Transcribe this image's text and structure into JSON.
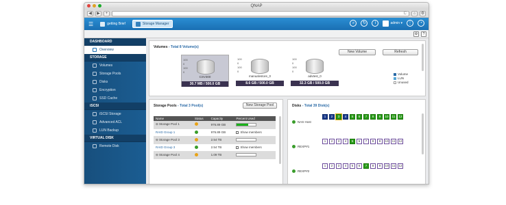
{
  "window": {
    "title": "QNAP"
  },
  "browser": {
    "back": "◀",
    "forward": "▶",
    "refresh": "C",
    "home": "⌂"
  },
  "appbar": {
    "tabs": [
      {
        "label": "getting Brief"
      },
      {
        "label": "Storage Manager"
      }
    ],
    "user": "admin ▾"
  },
  "sidebar": {
    "dashboard": "DASHBOARD",
    "overview": "Overview",
    "storage": "STORAGE",
    "storage_items": [
      "Volumes",
      "Storage Pools",
      "Disks",
      "Encryption",
      "SSD Cache"
    ],
    "iscsi": "iSCSI",
    "iscsi_items": [
      "iSCSI Storage",
      "Advanced ACL",
      "LUN Backup"
    ],
    "vdisk": "VIRTUAL DISK",
    "vdisk_items": [
      "Remote Disk"
    ]
  },
  "volumes": {
    "title": "Volumes",
    "count": "- Total 8 Volume(s)",
    "new_btn": "New Volume",
    "refresh_btn": "Refresh",
    "scale": [
      "100",
      "0",
      "100",
      "0"
    ],
    "items": [
      {
        "name": "CSV300",
        "cap": "30.7 MB / 500.0 GB"
      },
      {
        "name": "manualvstore_0",
        "cap": "8.6 GB / 500.0 GB"
      },
      {
        "name": "advtest_0",
        "cap": "32.3 GB / 500.0 GB"
      }
    ],
    "legend": [
      {
        "label": "Volume",
        "color": "#2a6aa6"
      },
      {
        "label": "LUN",
        "color": "#58a6d6"
      },
      {
        "label": "Unused",
        "color": "#ffffff"
      }
    ]
  },
  "pools": {
    "title": "Storage Pools",
    "count": "- Total 3 Pool(s)",
    "new_btn": "New Storage Pool",
    "headers": [
      "Name",
      "Status",
      "Capacity",
      "Percent Used"
    ],
    "rows": [
      {
        "name": "Storage Pool 1",
        "cap": "976.89 GB",
        "kind": "pool",
        "used": 0.6
      },
      {
        "name": "RAID Group 1",
        "cap": "976.89 GB",
        "kind": "raid",
        "show": "Show members"
      },
      {
        "name": "Storage Pool 3",
        "cap": "2.54 TB",
        "kind": "pool",
        "used": 0
      },
      {
        "name": "RAID Group 3",
        "cap": "2.54 TB",
        "kind": "raid",
        "show": "Show members"
      },
      {
        "name": "Storage Pool 4",
        "cap": "1.09 TB",
        "kind": "pool",
        "used": 0
      }
    ]
  },
  "disks": {
    "title": "Disks",
    "count": "- Total 39 Disk(s)",
    "enclosures": [
      {
        "name": "NAS Host",
        "disks": [
          "1",
          "2",
          "3",
          "4",
          "5",
          "6",
          "7",
          "8",
          "9",
          "10",
          "11",
          "12"
        ]
      },
      {
        "name": "REXP#1",
        "disks": [
          "1",
          "2",
          "3",
          "4",
          "5",
          "6",
          "7",
          "8",
          "9",
          "10",
          "11",
          "12"
        ]
      },
      {
        "name": "REXP#2",
        "disks": [
          "1",
          "2",
          "3",
          "4",
          "5",
          "6",
          "7",
          "8",
          "9",
          "10",
          "11",
          "12"
        ]
      }
    ]
  }
}
